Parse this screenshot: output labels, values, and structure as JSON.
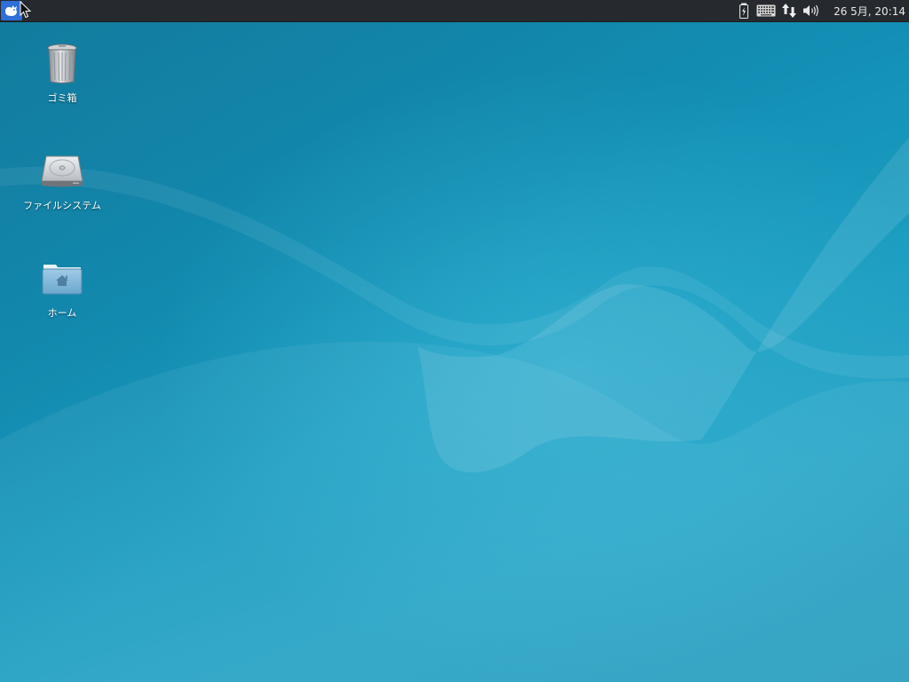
{
  "panel": {
    "menu_icon": "xfce-mouse-icon",
    "tray": {
      "icons": [
        "battery-icon",
        "keyboard-icon",
        "network-icon",
        "volume-icon"
      ],
      "clock": "26  5月, 20:14"
    }
  },
  "desktop": {
    "icons": [
      {
        "label": "ゴミ箱",
        "icon": "trash-icon"
      },
      {
        "label": "ファイルシステム",
        "icon": "drive-icon"
      },
      {
        "label": "ホーム",
        "icon": "home-folder-icon"
      }
    ]
  },
  "colors": {
    "panel": "#262a2e",
    "desktop": "#1a98bd",
    "menu_button": "#2f6fd6"
  }
}
